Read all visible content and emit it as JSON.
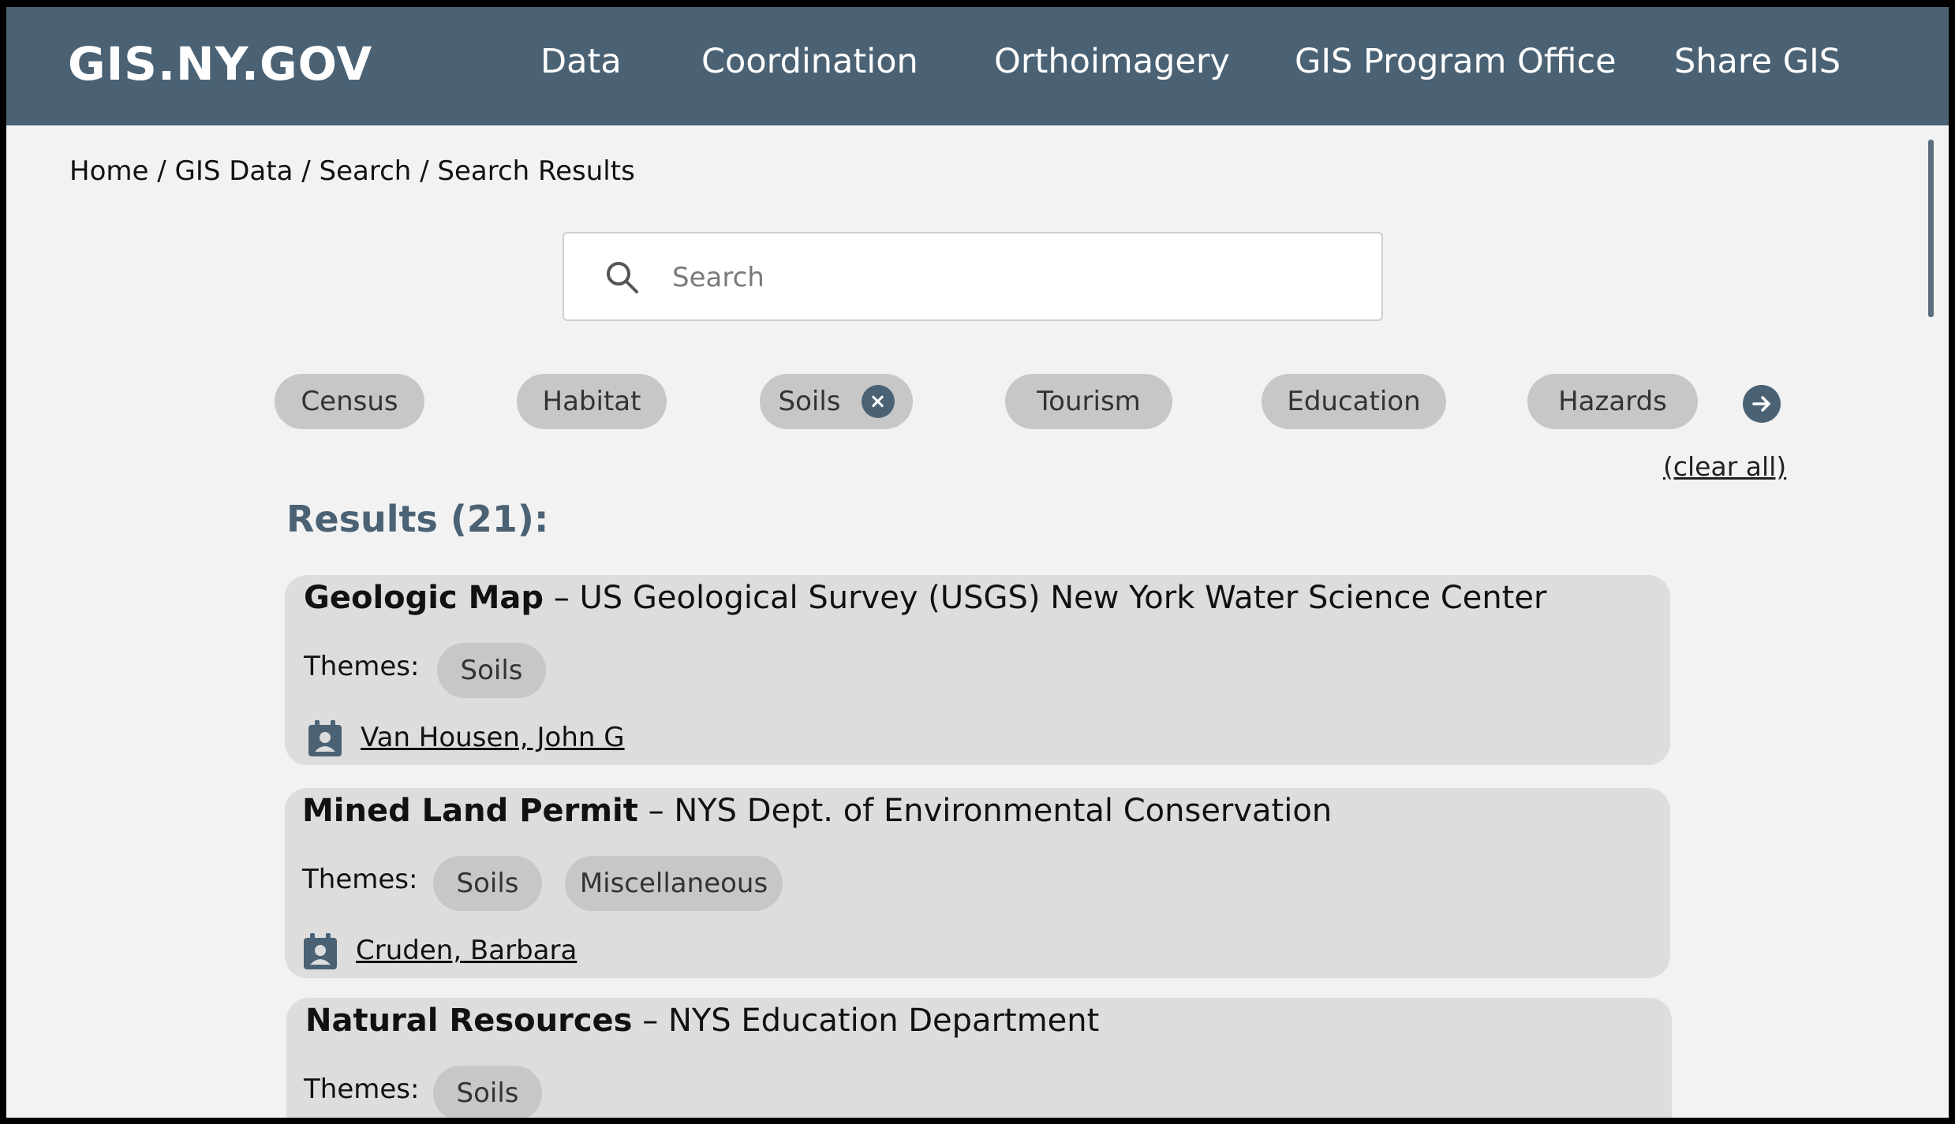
{
  "header": {
    "logo": "GIS.NY.GOV",
    "nav": [
      {
        "label": "Data"
      },
      {
        "label": "Coordination"
      },
      {
        "label": "Orthoimagery"
      },
      {
        "label": "GIS Program Office"
      },
      {
        "label": "Share GIS"
      }
    ]
  },
  "breadcrumb": {
    "items": [
      "Home",
      "GIS Data",
      "Search",
      "Search Results"
    ],
    "separator": " / "
  },
  "search": {
    "placeholder": "Search",
    "value": ""
  },
  "filters": {
    "chips": [
      {
        "label": "Census",
        "active": false
      },
      {
        "label": "Habitat",
        "active": false
      },
      {
        "label": "Soils",
        "active": true
      },
      {
        "label": "Tourism",
        "active": false
      },
      {
        "label": "Education",
        "active": false
      },
      {
        "label": "Hazards",
        "active": false
      }
    ],
    "remove_icon": "×",
    "clear_all_label": "(clear all)"
  },
  "results": {
    "heading": "Results (21):",
    "themes_label": "Themes:",
    "items": [
      {
        "title": "Geologic Map",
        "dash": " – ",
        "org": "US Geological Survey (USGS) New York Water Science Center",
        "themes": [
          "Soils"
        ],
        "contact": "Van Housen, John G"
      },
      {
        "title": "Mined Land Permit",
        "dash": " – ",
        "org": "NYS Dept. of Environmental Conservation",
        "themes": [
          "Soils",
          "Miscellaneous"
        ],
        "contact": "Cruden, Barbara"
      },
      {
        "title": "Natural Resources",
        "dash": " – ",
        "org": "NYS Education Department",
        "themes": [
          "Soils"
        ],
        "contact": ""
      }
    ]
  },
  "colors": {
    "header_bg": "#4a6274",
    "page_bg": "#f2f2f2",
    "chip_bg": "#c7c7c7",
    "card_bg": "#dedddd",
    "accent": "#4a6274"
  },
  "icons": {
    "search": "search-icon",
    "remove": "close-icon",
    "next": "arrow-right-icon",
    "contact": "contact-card-icon"
  }
}
